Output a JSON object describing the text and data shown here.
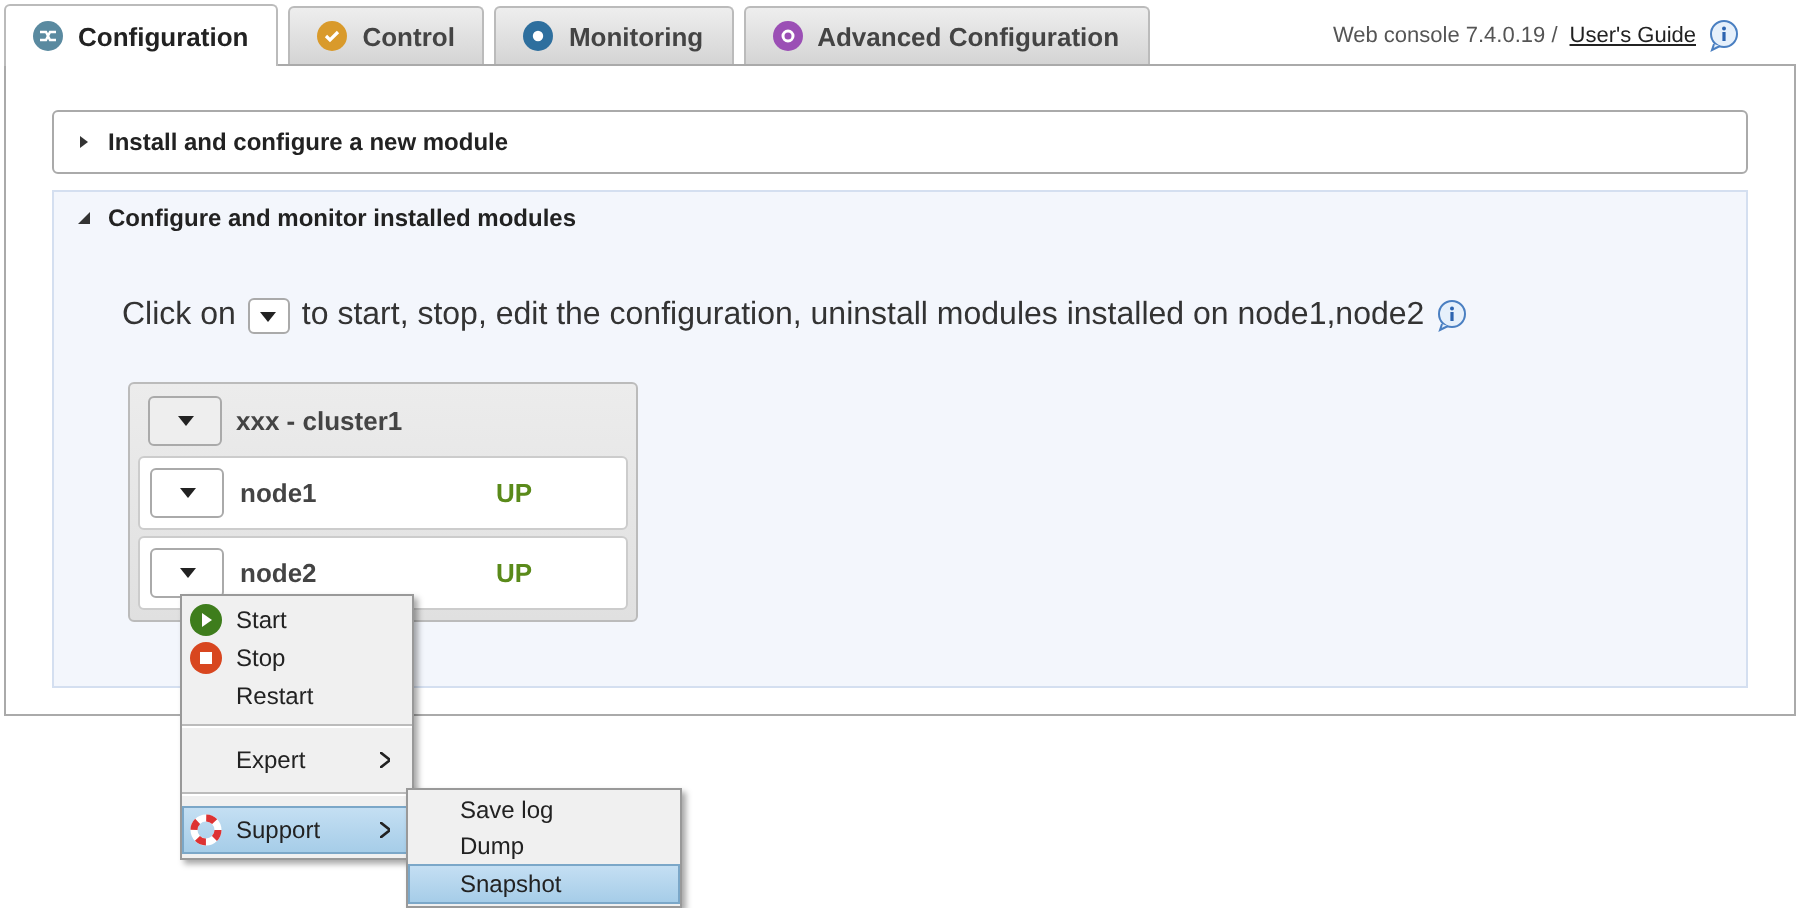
{
  "tabs": [
    {
      "label": "Configuration",
      "selected": true
    },
    {
      "label": "Control",
      "selected": false
    },
    {
      "label": "Monitoring",
      "selected": false
    },
    {
      "label": "Advanced Configuration",
      "selected": false
    }
  ],
  "header": {
    "version": "Web console 7.4.0.19 /",
    "guide_link": "User's Guide"
  },
  "sections": [
    {
      "title": "Install and configure a new module",
      "expanded": false
    },
    {
      "title": "Configure and monitor installed modules",
      "expanded": true
    }
  ],
  "instruction": {
    "before": "Click on",
    "after": "to start, stop, edit the configuration, uninstall modules installed on node1,node2"
  },
  "cluster": {
    "name": "xxx - cluster1",
    "nodes": [
      {
        "name": "node1",
        "status": "UP"
      },
      {
        "name": "node2",
        "status": "UP"
      }
    ]
  },
  "context_menu": {
    "groups": [
      [
        {
          "label": "Start",
          "kind": "start",
          "selected": false
        },
        {
          "label": "Stop",
          "kind": "stop",
          "selected": false
        },
        {
          "label": "Restart",
          "kind": "plain",
          "selected": false
        }
      ],
      [
        {
          "label": "Expert",
          "kind": "submenu",
          "selected": false
        }
      ],
      [
        {
          "label": "Support",
          "kind": "support",
          "selected": true
        }
      ]
    ]
  },
  "submenu": {
    "items": [
      {
        "label": "Save log",
        "selected": false
      },
      {
        "label": "Dump",
        "selected": false
      },
      {
        "label": "Snapshot",
        "selected": true
      }
    ]
  }
}
